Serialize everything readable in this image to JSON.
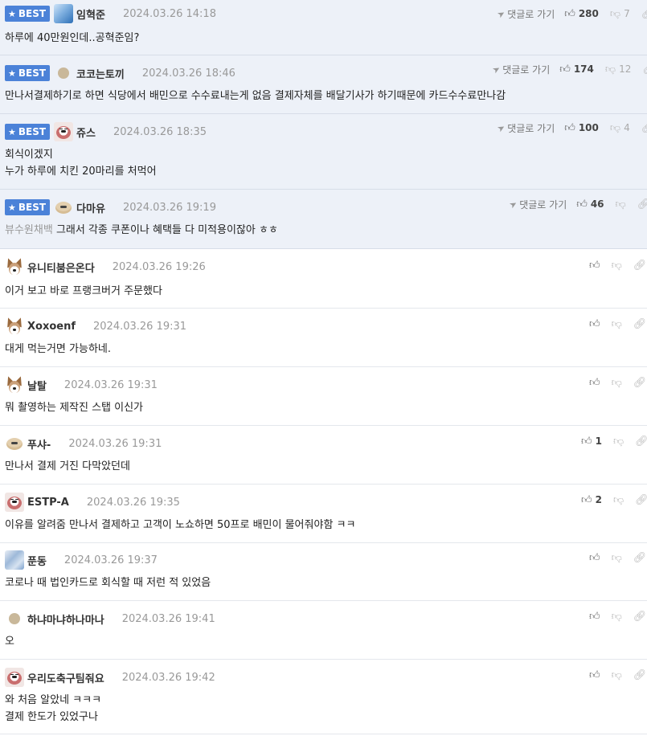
{
  "comments": [
    {
      "best": true,
      "badge": "BEST",
      "nick": "임혁준",
      "date": "2024.03.26 14:18",
      "reply_label": "댓글로 가기",
      "likes": "280",
      "dislikes": "7",
      "lines": [
        "하루에 40만원인데..공혁준임?"
      ],
      "prefix": ""
    },
    {
      "best": true,
      "badge": "BEST",
      "nick": "코코는토끼",
      "date": "2024.03.26 18:46",
      "reply_label": "댓글로 가기",
      "likes": "174",
      "dislikes": "12",
      "lines": [
        "만나서결제하기로 하면 식당에서 배민으로 수수료내는게 없음 결제자체를 배달기사가 하기때문에 카드수수료만나감"
      ],
      "prefix": ""
    },
    {
      "best": true,
      "badge": "BEST",
      "nick": "쥬스",
      "date": "2024.03.26 18:35",
      "reply_label": "댓글로 가기",
      "likes": "100",
      "dislikes": "4",
      "lines": [
        "회식이겠지",
        "누가 하루에 치킨 20마리를 처먹어"
      ],
      "prefix": ""
    },
    {
      "best": true,
      "badge": "BEST",
      "nick": "다마유",
      "date": "2024.03.26 19:19",
      "reply_label": "댓글로 가기",
      "likes": "46",
      "dislikes": "",
      "lines": [
        "그래서 각종 쿠폰이나 혜택들 다 미적용이잖아 ㅎㅎ"
      ],
      "prefix": "뷰수원채백"
    },
    {
      "best": false,
      "nick": "유니티붐은온다",
      "date": "2024.03.26 19:26",
      "likes": "",
      "dislikes": "",
      "lines": [
        "이거 보고 바로 프랭크버거 주문했다"
      ],
      "prefix": ""
    },
    {
      "best": false,
      "nick": "Xoxoenf",
      "date": "2024.03.26 19:31",
      "likes": "",
      "dislikes": "",
      "lines": [
        "대게 먹는거면 가능하네."
      ],
      "prefix": ""
    },
    {
      "best": false,
      "nick": "날탈",
      "date": "2024.03.26 19:31",
      "likes": "",
      "dislikes": "",
      "lines": [
        "뭐 촬영하는 제작진 스탭 이신가"
      ],
      "prefix": ""
    },
    {
      "best": false,
      "nick": "푸샤-",
      "date": "2024.03.26 19:31",
      "likes": "1",
      "dislikes": "",
      "lines": [
        "만나서 결제 거진 다막았던데"
      ],
      "prefix": ""
    },
    {
      "best": false,
      "nick": "ESTP-A",
      "date": "2024.03.26 19:35",
      "likes": "2",
      "dislikes": "",
      "lines": [
        "이유를 알려줌 만나서 결제하고 고객이 노쇼하면 50프로 배민이 물어줘야함 ㅋㅋ"
      ],
      "prefix": ""
    },
    {
      "best": false,
      "nick": "푼동",
      "date": "2024.03.26 19:37",
      "likes": "",
      "dislikes": "",
      "lines": [
        "코로나 때 법인카드로 회식할 때 저런 적 있었음"
      ],
      "prefix": ""
    },
    {
      "best": false,
      "nick": "하냐마냐하나마나",
      "date": "2024.03.26 19:41",
      "likes": "",
      "dislikes": "",
      "lines": [
        "오"
      ],
      "prefix": ""
    },
    {
      "best": false,
      "nick": "우리도축구팀줘요",
      "date": "2024.03.26 19:42",
      "likes": "",
      "dislikes": "",
      "lines": [
        "와 처음 알았네 ㅋㅋㅋ",
        "결제 한도가 있었구나"
      ],
      "prefix": ""
    }
  ],
  "icons": {
    "like": "thumbs-up-icon",
    "dislike": "thumbs-down-icon",
    "link": "link-icon",
    "reply": "reply-arrow-icon",
    "best": "star-icon"
  },
  "colors": {
    "best_badge": "#4b82d8",
    "best_row_bg": "#edf1f8"
  }
}
